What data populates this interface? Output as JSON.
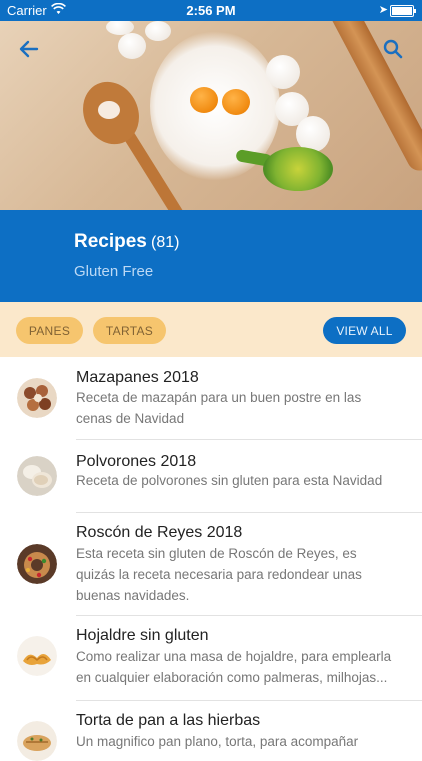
{
  "status_bar": {
    "carrier": "Carrier",
    "time": "2:56 PM"
  },
  "header": {
    "title": "Recipes",
    "count": "(81)",
    "subtitle": "Gluten Free"
  },
  "filters": {
    "chips": [
      "PANES",
      "TARTAS"
    ],
    "view_all": "VIEW ALL"
  },
  "recipes": [
    {
      "name": "Mazapanes 2018",
      "description": "Receta de mazapán para un buen postre en las cenas de Navidad"
    },
    {
      "name": "Polvorones 2018",
      "description": "Receta de polvorones sin gluten para esta Navidad"
    },
    {
      "name": "Roscón de Reyes 2018",
      "description": "Esta receta sin gluten de Roscón de Reyes, es quizás la receta necesaria para redondear unas buenas navidades."
    },
    {
      "name": "Hojaldre sin gluten",
      "description": "Como realizar una masa de hojaldre, para emplearla en cualquier elaboración como palmeras, milhojas..."
    },
    {
      "name": "Torta de pan a las hierbas",
      "description": "Un magnifico pan plano, torta, para acompañar"
    }
  ],
  "colors": {
    "primary": "#0d6fc4",
    "chip": "#f6c56e",
    "filter_bar": "#fbe8cb"
  },
  "icons": {
    "back": "arrow-left-icon",
    "search": "search-icon",
    "wifi": "wifi-icon",
    "location": "location-arrow-icon",
    "battery": "battery-icon"
  }
}
